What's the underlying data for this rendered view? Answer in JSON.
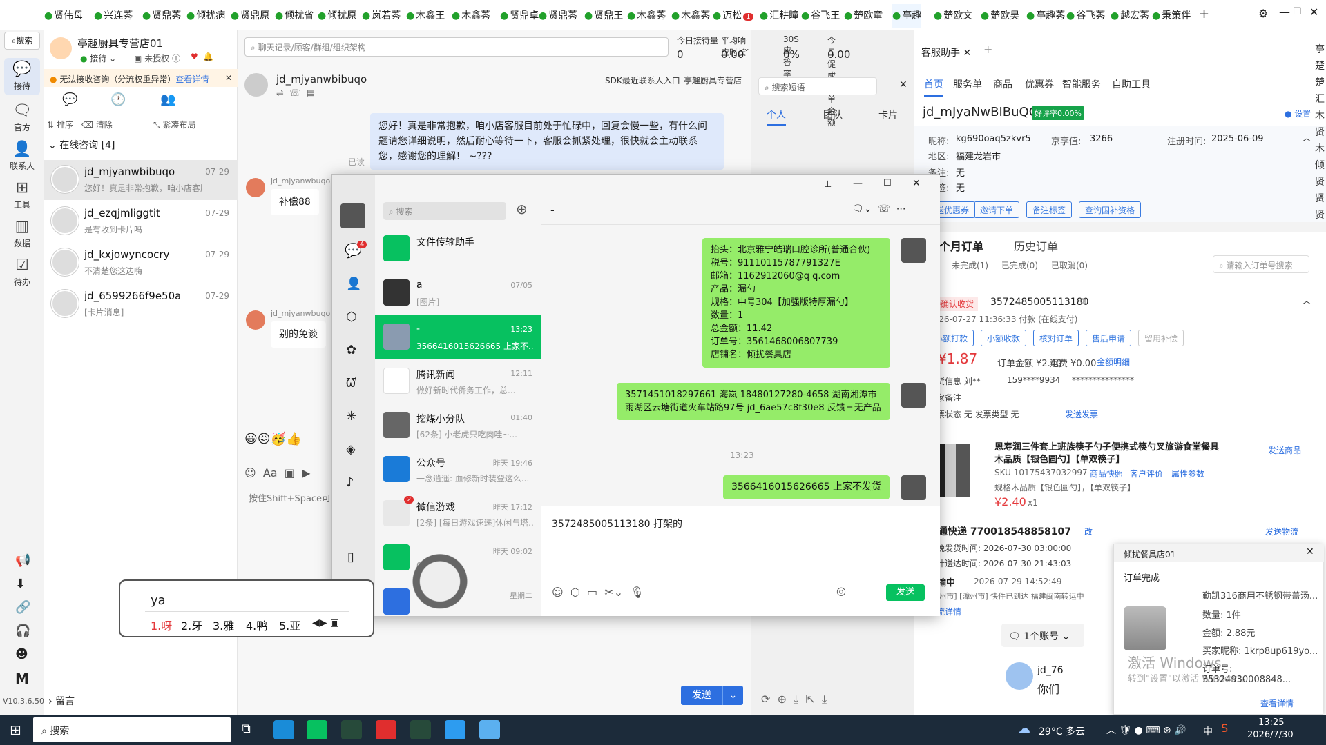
{
  "tabs": [
    "贤伟母",
    "兴连莠",
    "贤鼎莠",
    "倾扰病",
    "贤鼎原",
    "倾扰省",
    "倾扰原",
    "岚若莠",
    "木鑫王",
    "木鑫莠",
    "贤鼎卓",
    "贤鼎莠",
    "贤鼎王",
    "木鑫莠",
    "木鑫莠",
    "迈松",
    "汇耕瞳",
    "谷飞王",
    "楚欧童",
    "亭趣",
    "楚欧文",
    "楚欧昊",
    "亭趣莠",
    "谷飞莠",
    "越宏莠",
    "秉策伴"
  ],
  "tab_badge": "1",
  "leftnav": {
    "search": "搜索",
    "items": [
      "接待",
      "官方",
      "联系人",
      "工具",
      "数据",
      "待办"
    ],
    "version": "V10.3.6.500"
  },
  "store": {
    "name": "亭趣厨具专营店01",
    "status": "接待",
    "auth": "未授权",
    "warning": "无法接收咨询（分流权重异常）",
    "warning_link": "查看详情",
    "sort": "排序",
    "clear": "清除",
    "layout": "紧凑布局",
    "online_title": "在线咨询 [4]",
    "leave_msg": "留言"
  },
  "conversations": [
    {
      "name": "jd_mjyanwbibuqo",
      "preview": "您好！真是非常抱歉，咱小店客服...",
      "time": "07-29"
    },
    {
      "name": "jd_ezqjmliggtit",
      "preview": "是有收到卡片吗",
      "time": "07-29"
    },
    {
      "name": "jd_kxjowyncocry",
      "preview": "不清楚您这边嗨",
      "time": "07-29"
    },
    {
      "name": "jd_6599266f9e50a",
      "preview": "[卡片消息]",
      "time": "07-29"
    }
  ],
  "search_placeholder": "聊天记录/顾客/群组/组织架构",
  "stats": [
    {
      "label": "今日接待量",
      "value": "0"
    },
    {
      "label": "平均响应时长",
      "value": "0.00"
    },
    {
      "label": "30S应答率",
      "value": "0%"
    },
    {
      "label": "今日促成下单金额",
      "value": "0.00"
    }
  ],
  "chat": {
    "customer": "jd_mjyanwbibuqo",
    "sdk": "SDK最近联系人入口",
    "store": "亭趣厨具专营店",
    "msg1": "您好！真是非常抱歉，咱小店客服目前处于忙碌中，回复会慢一些，有什么问题请您详细说明，然后耐心等待一下，客服会抓紧处理，很快就会主动联系您，感谢您的理解！ ~???",
    "read": "已读",
    "sender": "jd_mjyanwbuqo",
    "msg2": "补偿88",
    "msg3": "别的免谈",
    "input_hint": "按住Shift+Space可",
    "send": "发送",
    "quick_search": "搜索短语",
    "quick_tabs": [
      "个人",
      "团队",
      "卡片"
    ]
  },
  "ime": {
    "input": "ya",
    "candidates": [
      "1.呀",
      "2.牙",
      "3.雅",
      "4.鸭",
      "5.亚"
    ]
  },
  "wechat": {
    "search": "搜索",
    "title": "-",
    "chats": [
      {
        "name": "文件传输助手",
        "preview": "",
        "time": ""
      },
      {
        "name": "a",
        "preview": "[图片]",
        "time": "07/05"
      },
      {
        "name": "-",
        "preview": "3566416015626665  上家不...",
        "time": "13:23"
      },
      {
        "name": "腾讯新闻",
        "preview": "做好新时代侨务工作，总...",
        "time": "12:11"
      },
      {
        "name": "挖煤小分队",
        "preview": "[62条] 小老虎只吃肉哇~...",
        "time": "01:40"
      },
      {
        "name": "公众号",
        "preview": "一念逍遥: 血修新时装登这么...",
        "time": "昨天 19:46"
      },
      {
        "name": "微信游戏",
        "preview": "[2条] [每日游戏速递]休闲与塔...",
        "time": "昨天 17:12"
      },
      {
        "name": "",
        "preview": "00",
        "time": "昨天 09:02"
      },
      {
        "name": "",
        "preview": "",
        "time": "星期二"
      }
    ],
    "badges": {
      "chat": "4",
      "game": "2"
    },
    "msg1": [
      "抬头：北京雅宁皓瑞口腔诊所(普通合伙)",
      "税号：91110115787791327E",
      "邮箱：1162912060@q q.com",
      "产品：漏勺",
      "规格：中号304【加强版特厚漏勺】",
      "数量：1",
      "总金额：11.42",
      "订单号：3561468006807739",
      "店铺名：倾扰餐具店"
    ],
    "msg2": "3571451018297661 海岚 18480127280-4658 湖南湘潭市雨湖区云塘街道火车站路97号  jd_6ae57c8f30e8 反馈三无产品",
    "time": "13:23",
    "msg3": "3566416015626665  上家不发货",
    "input": "3572485005113180  打架的",
    "send": "发送"
  },
  "right": {
    "tab": "客服助手",
    "nav": [
      "首页",
      "服务单",
      "商品",
      "优惠券",
      "智能服务",
      "自助工具"
    ],
    "customer": "jd_mJyaNwBIBuQO",
    "rate": "好评率0.00%",
    "setting": "设置",
    "nick_label": "昵称:",
    "nick": "kg690oaq5zkvr5",
    "score_label": "京享值:",
    "score": "3266",
    "reg_label": "注册时间:",
    "reg": "2025-06-09",
    "area_label": "地区:",
    "area": "福建龙岩市",
    "note_label": "备注:",
    "note": "无",
    "tag_label": "标签:",
    "tag": "无",
    "btns": [
      "发送优惠券",
      "邀请下单",
      "备注标签",
      "查询国补资格"
    ],
    "order_tabs": [
      "三个月订单",
      "历史订单"
    ],
    "order_sub": [
      "(1)",
      "未完成(1)",
      "已完成(0)",
      "已取消(0)"
    ],
    "order_search": "请输入订单号搜索",
    "order_status": "待确认收货",
    "order_id": "3572485005113180",
    "order_time": "2026-07-27 11:36:33 付款 (在线支付)",
    "order_btns": [
      "小额打款",
      "小额收款",
      "核对订单",
      "售后申请",
      "留用补偿"
    ],
    "pay": "¥1.87",
    "order_amt": "订单金额 ¥2.40",
    "freight": "运费 ¥0.00",
    "amount_detail": "金额明细",
    "recv": "收货信息 刘**",
    "phone": "159****9934",
    "stub": "***************",
    "buyer_note": "买家备注",
    "invoice": "发票状态 无  发票类型 无",
    "invoice_link": "发送发票",
    "goods_title": "恩寿润三件套上班族筷子勺子便携式筷勺叉旅游食堂餐具 木品质【银色圆勺】【单双筷子】",
    "goods_sku": "SKU 10175437032997",
    "goods_links": [
      "商品快照",
      "客户评价",
      "属性参数"
    ],
    "goods_spec": "规格木品质【银色圆勺】，【单双筷子】",
    "goods_price": "¥2.40",
    "goods_qty": "x1",
    "send_goods": "发送商品",
    "express": "申通快递 770018548858107",
    "express_edit": "改",
    "send_logistics": "发送物流",
    "latest_ship": "最晚发货时间:  2026-07-30 03:00:00",
    "eta": "预计送达时间:  2026-07-30 21:43:03",
    "transit": "运输中",
    "transit_time": "2026-07-29 14:52:49",
    "transit_text": "[漳州市] [漳州市] 快件已到达 福建闽南转运中",
    "logistics_detail": "物流详情",
    "accounts": "1个账号",
    "jd_prefix": "jd_76",
    "you": "你们"
  },
  "notif": {
    "store": "倾扰餐具店01",
    "title": "订单完成",
    "product": "勤凯316商用不锈钢带盖汤...",
    "qty": "数量: 1件",
    "amount": "金额: 2.88元",
    "buyer": "买家昵称: 1krp8up619yo...",
    "order": "订单号: 35324930008848...",
    "more": "查看详情",
    "activate": "激活 Windows",
    "activate_sub": "转到\"设置\"以激活 Windows。"
  },
  "taskbar": {
    "search": "搜索",
    "weather": "29°C 多云",
    "time": "13:25",
    "date": "2026/7/30",
    "lang": "中"
  },
  "colors": {
    "accent": "#2d6fe0",
    "green": "#07c160",
    "bubble": "#95ec69",
    "price": "#e4393c"
  }
}
